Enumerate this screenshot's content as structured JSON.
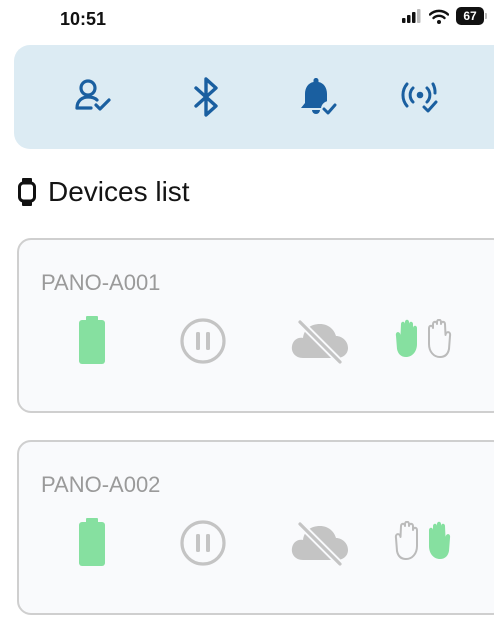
{
  "status_bar": {
    "time": "10:51",
    "battery": "67"
  },
  "toolbar": {
    "items": [
      {
        "icon": "user-check-icon"
      },
      {
        "icon": "bluetooth-icon"
      },
      {
        "icon": "bell-check-icon"
      },
      {
        "icon": "broadcast-check-icon"
      }
    ]
  },
  "devices_section": {
    "title": "Devices list",
    "icon": "watch-icon"
  },
  "devices": [
    {
      "name": "PANO-A001",
      "battery_status": "full",
      "playback": "paused",
      "cloud": "offline",
      "active_hand": "left"
    },
    {
      "name": "PANO-A002",
      "battery_status": "full",
      "playback": "paused",
      "cloud": "offline",
      "active_hand": "right"
    }
  ],
  "colors": {
    "accent": "#1a5fa0",
    "toolbar_bg": "#dcebf3",
    "active_green": "#86e0a0",
    "inactive_gray": "#c4c4c4",
    "card_border": "#cfcfcf"
  }
}
